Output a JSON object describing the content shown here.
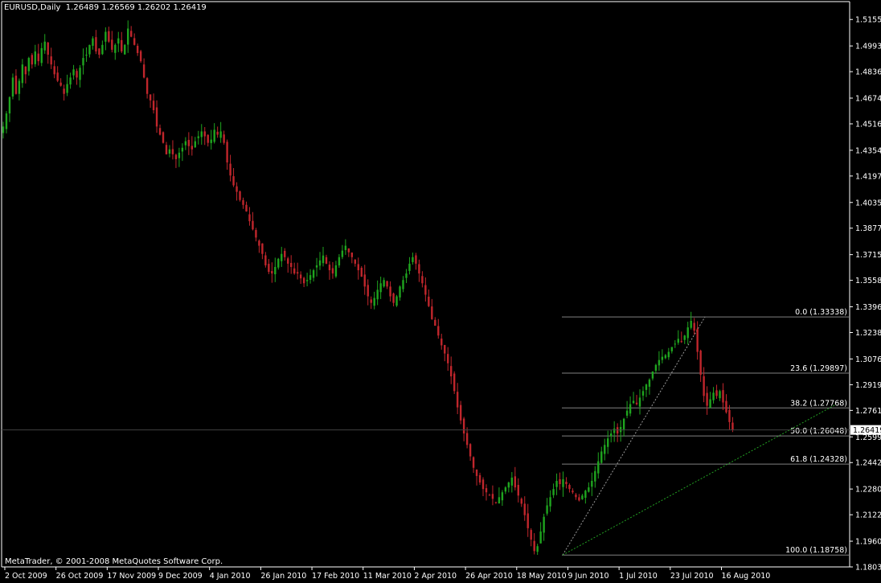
{
  "header": {
    "symbol": "EURUSD,Daily",
    "open": "1.26489",
    "high": "1.26569",
    "low": "1.26202",
    "close": "1.26419"
  },
  "copyright": "MetaTrader, © 2001-2008 MetaQuotes Software Corp.",
  "colors": {
    "background": "#000000",
    "axis": "#ffffff",
    "bull": "#1fa51f",
    "bear": "#c0262c",
    "fib_line": "#808080",
    "trend_line": "#22a022",
    "bid_line": "#404040"
  },
  "chart_data": {
    "type": "candlestick",
    "symbol": "EURUSD",
    "timeframe": "Daily",
    "ylim": [
      1.1803,
      1.5265
    ],
    "y_ticks": [
      "1.51555",
      "1.49935",
      "1.48360",
      "1.46740",
      "1.45165",
      "1.43545",
      "1.41970",
      "1.40350",
      "1.38775",
      "1.37155",
      "1.35580",
      "1.33960",
      "1.32385",
      "1.30765",
      "1.29190",
      "1.27615",
      "1.25995",
      "1.24420",
      "1.22800",
      "1.21225",
      "1.19605",
      "1.18030"
    ],
    "x_ticks": [
      "2 Oct 2009",
      "26 Oct 2009",
      "17 Nov 2009",
      "9 Dec 2009",
      "4 Jan 2010",
      "26 Jan 2010",
      "17 Feb 2010",
      "11 Mar 2010",
      "2 Apr 2010",
      "26 Apr 2010",
      "18 May 2010",
      "9 Jun 2010",
      "1 Jul 2010",
      "23 Jul 2010",
      "16 Aug 2010"
    ],
    "current_price": "1.26419",
    "closes": [
      1.45,
      1.458,
      1.468,
      1.48,
      1.47,
      1.478,
      1.488,
      1.482,
      1.492,
      1.488,
      1.496,
      1.49,
      1.498,
      1.502,
      1.494,
      1.488,
      1.482,
      1.478,
      1.475,
      1.47,
      1.476,
      1.48,
      1.485,
      1.48,
      1.486,
      1.492,
      1.494,
      1.5,
      1.504,
      1.496,
      1.494,
      1.5,
      1.508,
      1.502,
      1.497,
      1.5,
      1.504,
      1.496,
      1.5,
      1.51,
      1.505,
      1.5,
      1.495,
      1.49,
      1.48,
      1.47,
      1.466,
      1.46,
      1.45,
      1.445,
      1.44,
      1.433,
      1.436,
      1.433,
      1.43,
      1.434,
      1.437,
      1.441,
      1.438,
      1.436,
      1.441,
      1.444,
      1.447,
      1.444,
      1.44,
      1.442,
      1.448,
      1.445,
      1.447,
      1.44,
      1.428,
      1.42,
      1.414,
      1.41,
      1.405,
      1.402,
      1.398,
      1.392,
      1.387,
      1.382,
      1.377,
      1.372,
      1.365,
      1.361,
      1.36,
      1.364,
      1.369,
      1.372,
      1.37,
      1.366,
      1.364,
      1.36,
      1.36,
      1.357,
      1.354,
      1.356,
      1.359,
      1.362,
      1.365,
      1.368,
      1.371,
      1.366,
      1.362,
      1.36,
      1.365,
      1.37,
      1.374,
      1.377,
      1.373,
      1.37,
      1.366,
      1.362,
      1.358,
      1.352,
      1.346,
      1.342,
      1.345,
      1.35,
      1.354,
      1.356,
      1.352,
      1.346,
      1.342,
      1.346,
      1.352,
      1.356,
      1.36,
      1.366,
      1.37,
      1.366,
      1.36,
      1.354,
      1.347,
      1.34,
      1.332,
      1.328,
      1.322,
      1.316,
      1.311,
      1.305,
      1.297,
      1.288,
      1.278,
      1.27,
      1.262,
      1.255,
      1.248,
      1.241,
      1.236,
      1.232,
      1.228,
      1.226,
      1.224,
      1.222,
      1.22,
      1.223,
      1.226,
      1.229,
      1.232,
      1.235,
      1.229,
      1.224,
      1.219,
      1.212,
      1.204,
      1.197,
      1.19,
      1.193,
      1.202,
      1.211,
      1.218,
      1.223,
      1.228,
      1.233,
      1.231,
      1.234,
      1.231,
      1.228,
      1.226,
      1.223,
      1.221,
      1.224,
      1.227,
      1.229,
      1.233,
      1.239,
      1.245,
      1.251,
      1.255,
      1.259,
      1.262,
      1.265,
      1.262,
      1.266,
      1.271,
      1.276,
      1.28,
      1.282,
      1.28,
      1.284,
      1.288,
      1.292,
      1.295,
      1.3,
      1.304,
      1.307,
      1.309,
      1.31,
      1.312,
      1.315,
      1.317,
      1.32,
      1.318,
      1.322,
      1.327,
      1.331,
      1.325,
      1.312,
      1.298,
      1.285,
      1.279,
      1.283,
      1.287,
      1.285,
      1.288,
      1.281,
      1.275,
      1.269,
      1.264
    ],
    "fibonacci": {
      "levels": [
        {
          "label": "0.0 (1.33338)",
          "value": 1.33338
        },
        {
          "label": "23.6 (1.29897)",
          "value": 1.29897
        },
        {
          "label": "38.2 (1.27768)",
          "value": 1.27768
        },
        {
          "label": "50.0 (1.26048)",
          "value": 1.26048
        },
        {
          "label": "61.8 (1.24328)",
          "value": 1.24328
        },
        {
          "label": "100.0 (1.18758)",
          "value": 1.18758
        }
      ]
    },
    "trend_line": {
      "start": 1.18758,
      "end": 1.33338
    }
  }
}
